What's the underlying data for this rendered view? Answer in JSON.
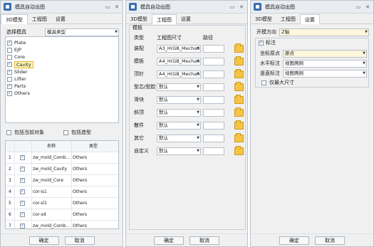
{
  "window_title": "模具自动出图",
  "tabs": [
    "3D模型",
    "工程图",
    "设置"
  ],
  "buttons": {
    "ok": "确定",
    "cancel": "取消"
  },
  "panel1": {
    "select_label": "选择模具",
    "select_value": "模具类型",
    "list_items": [
      {
        "label": "Plate",
        "checked": true
      },
      {
        "label": "EJP",
        "checked": false
      },
      {
        "label": "Core",
        "checked": false
      },
      {
        "label": "Cavity",
        "checked": true
      },
      {
        "label": "Slider",
        "checked": true
      },
      {
        "label": "Lifter",
        "checked": false
      },
      {
        "label": "Parts",
        "checked": true
      },
      {
        "label": "Others",
        "checked": true
      }
    ],
    "opt_current": "包括当前对象",
    "opt_assembly": "包括造型",
    "table_headers": [
      "",
      "",
      "名称",
      "类型"
    ],
    "table_rows": [
      {
        "idx": "1",
        "name": "zw_mold_Comb...",
        "type": "Others"
      },
      {
        "idx": "2",
        "name": "zw_mold_Cavity",
        "type": "Others"
      },
      {
        "idx": "3",
        "name": "zw_mold_Core",
        "type": "Others"
      },
      {
        "idx": "4",
        "name": "cor-is1",
        "type": "Others"
      },
      {
        "idx": "5",
        "name": "cor-sl1",
        "type": "Others"
      },
      {
        "idx": "6",
        "name": "cor-xd",
        "type": "Others"
      },
      {
        "idx": "7",
        "name": "zw_mold_Comb...",
        "type": "Others"
      }
    ]
  },
  "panel2": {
    "group_title": "模板",
    "headers": [
      "类型",
      "工程图尺寸",
      "路径"
    ],
    "rows": [
      {
        "label": "装配",
        "value": "A3_H(GB_Mechan"
      },
      {
        "label": "模板",
        "value": "A4_H(GB_Mechan"
      },
      {
        "label": "顶针",
        "value": "A4_H(GB_Mechan"
      },
      {
        "label": "型芯/型腔",
        "value": "默认"
      },
      {
        "label": "滑块",
        "value": "默认"
      },
      {
        "label": "斜顶",
        "value": "默认"
      },
      {
        "label": "散件",
        "value": "默认"
      },
      {
        "label": "其它",
        "value": "默认"
      },
      {
        "label": "自定义",
        "value": "默认"
      }
    ]
  },
  "panel3": {
    "direction_label": "开模方向",
    "direction_value": "Z轴",
    "annotation_label": "标注",
    "origin_label": "坐标原点",
    "origin_value": "原点",
    "horizontal_label": "水平标注",
    "horizontal_value": "视图两侧",
    "vertical_label": "竖直标注",
    "vertical_value": "视图两侧",
    "max_only_label": "仅最大尺寸"
  }
}
